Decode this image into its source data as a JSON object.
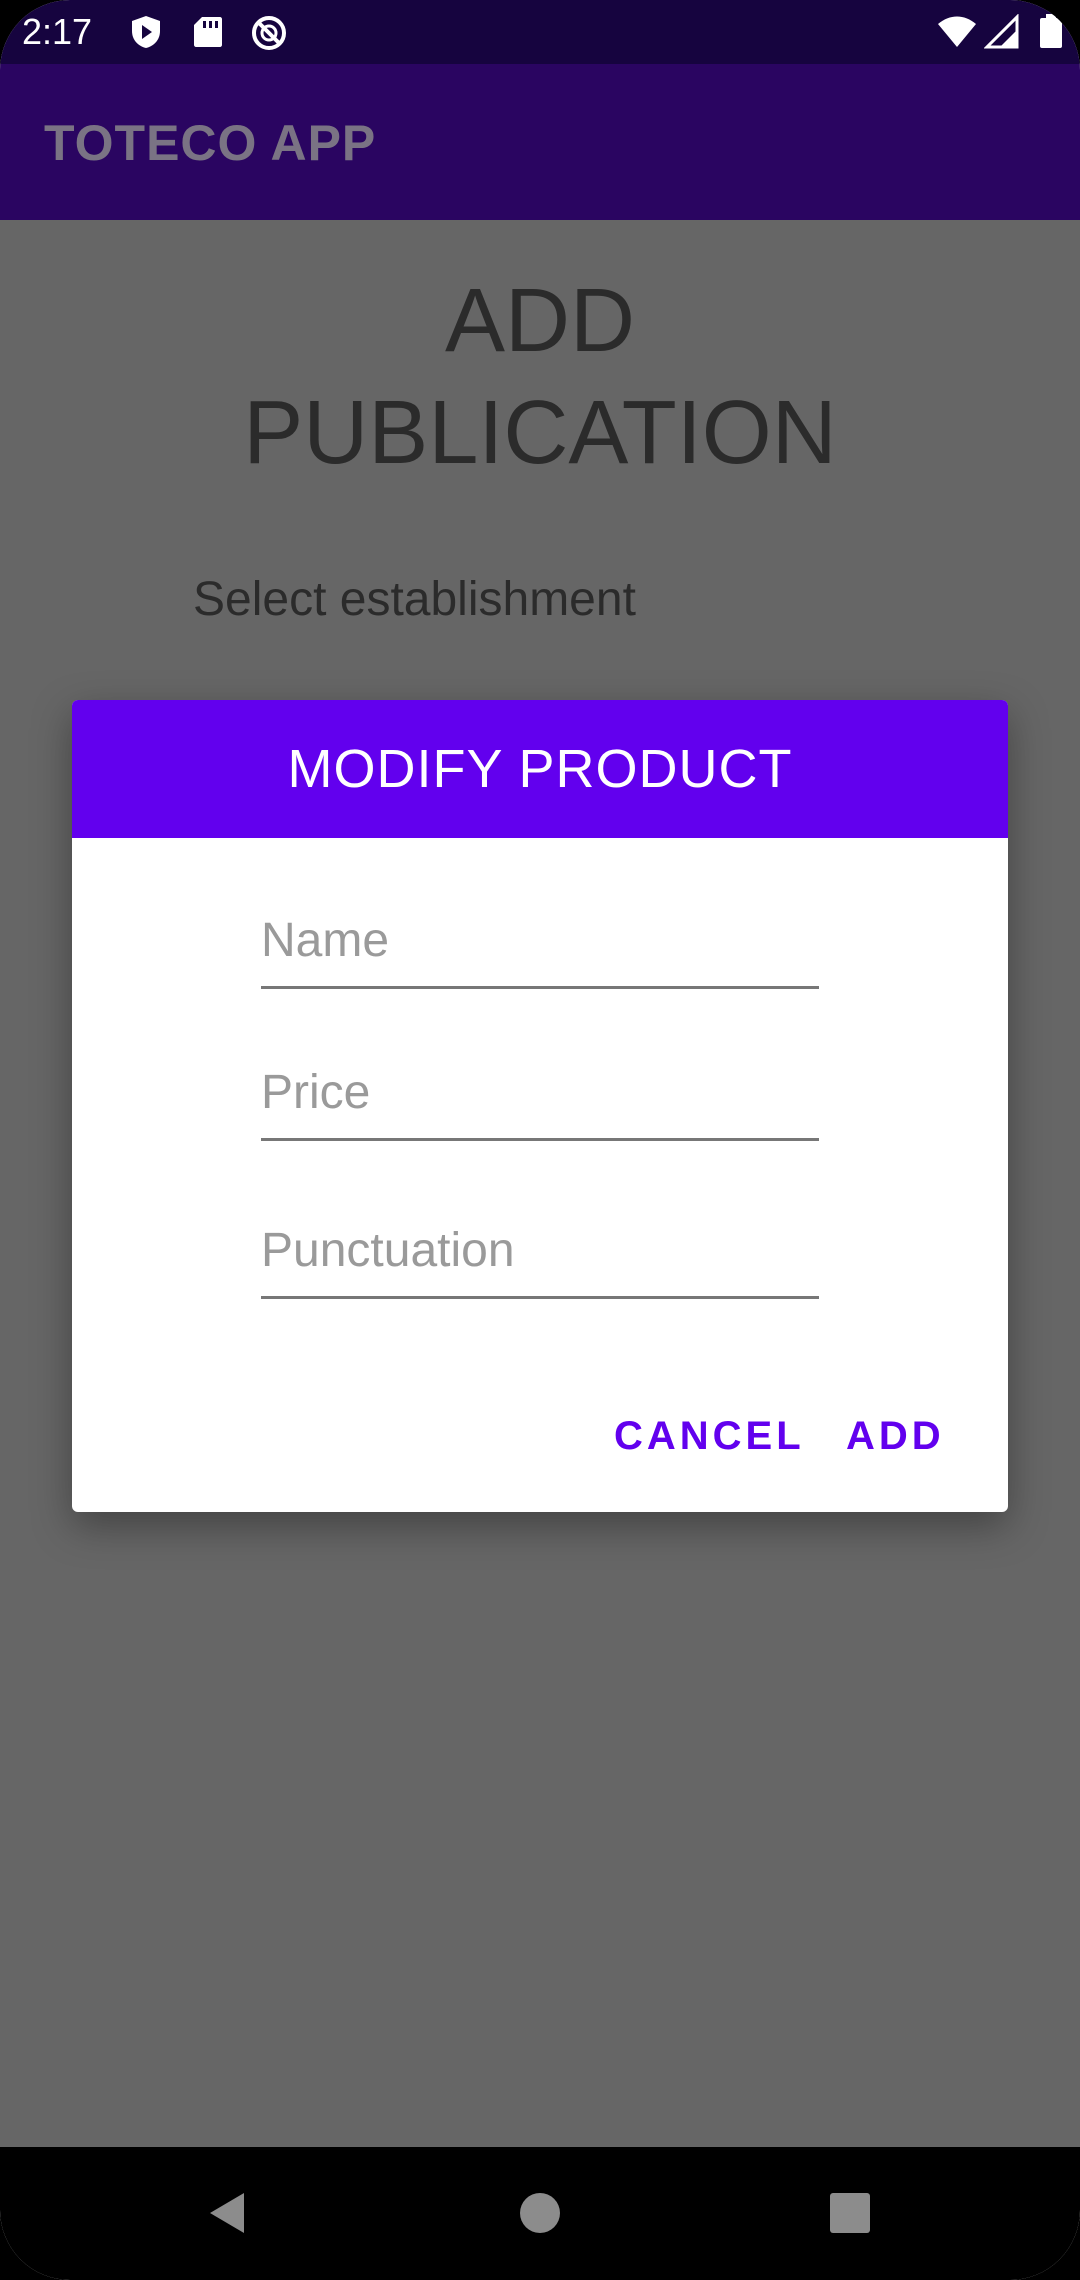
{
  "status_bar": {
    "time": "2:17",
    "left_icons": [
      "shield-play-icon",
      "sd-card-icon",
      "do-not-disturb-icon"
    ],
    "right_icons": [
      "wifi-icon",
      "signal-icon",
      "battery-icon"
    ]
  },
  "app_bar": {
    "title": "TOTECO APP"
  },
  "page": {
    "title_line1": "ADD",
    "title_line2": "PUBLICATION",
    "select_label": "Select establishment"
  },
  "dialog": {
    "title": "MODIFY PRODUCT",
    "fields": {
      "name": {
        "placeholder": "Name",
        "value": ""
      },
      "price": {
        "placeholder": "Price",
        "value": ""
      },
      "punctuation": {
        "placeholder": "Punctuation",
        "value": ""
      }
    },
    "cancel_label": "CANCEL",
    "add_label": "ADD"
  },
  "nav_bar": {
    "icons": [
      "back-icon",
      "home-icon",
      "recents-icon"
    ]
  },
  "colors": {
    "status_bar": "#16043f",
    "app_bar": "#2a0561",
    "accent": "#6200ee",
    "scrim": "#666666"
  }
}
